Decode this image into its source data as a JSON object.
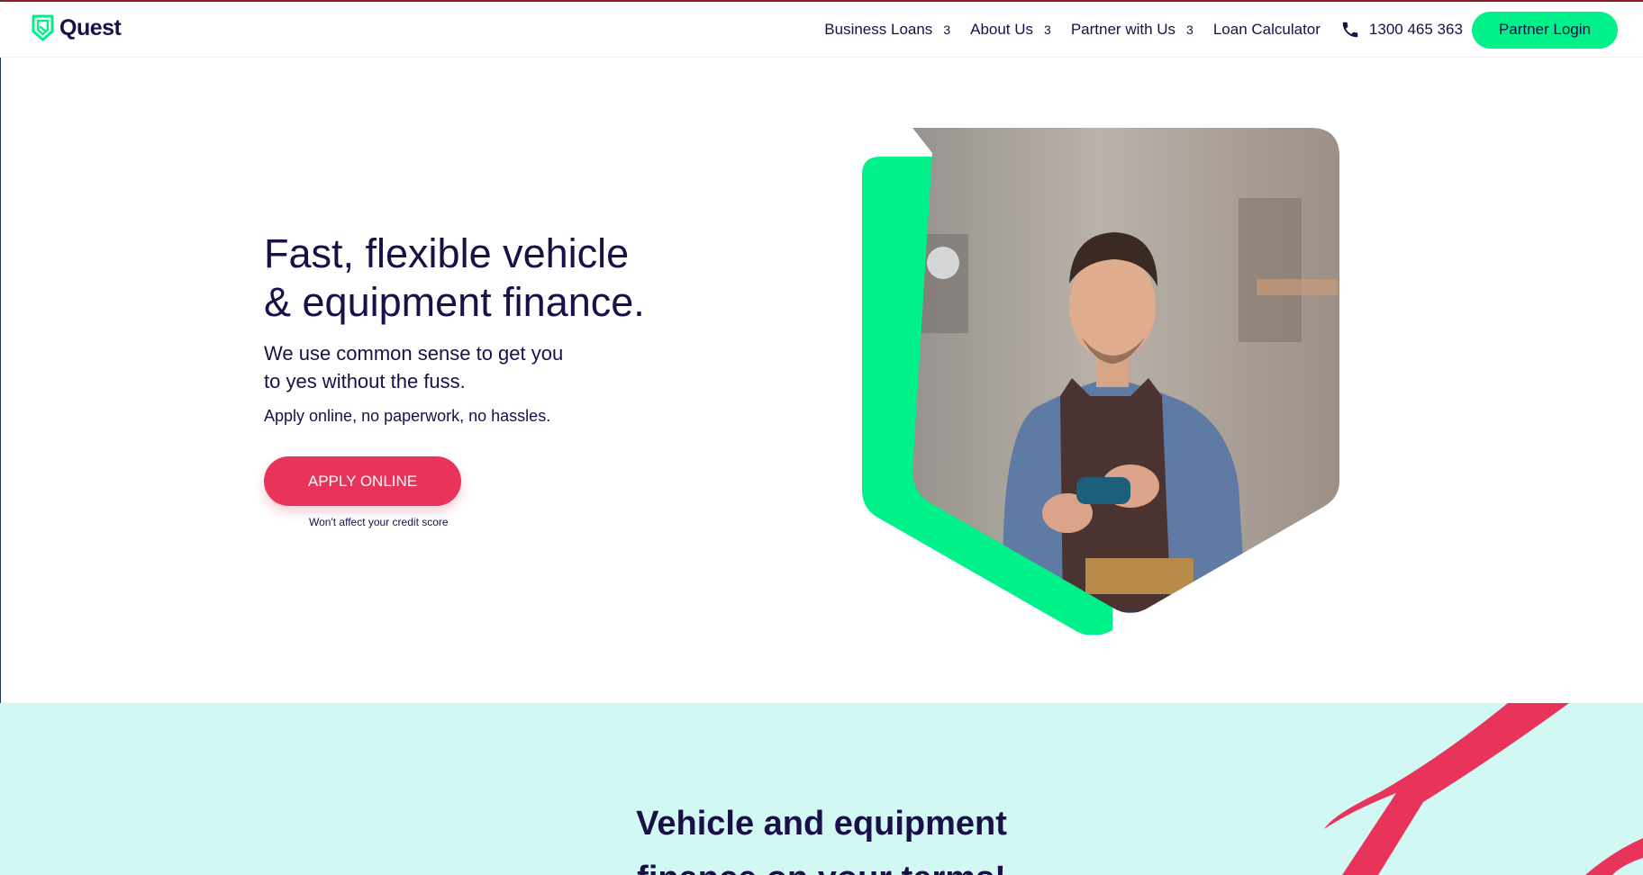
{
  "brand": {
    "name": "Quest",
    "accent": "#00f08a",
    "primary_text": "#1b0f4a",
    "cta": "#e8345b",
    "section_bg": "#d2f8f3"
  },
  "nav": {
    "items": [
      {
        "label": "Business Loans",
        "chevron": "3"
      },
      {
        "label": "About Us",
        "chevron": "3"
      },
      {
        "label": "Partner with Us",
        "chevron": "3"
      },
      {
        "label": "Loan Calculator"
      }
    ],
    "phone_icon": "phone-icon",
    "phone": "1300 465 363",
    "partner_login": "Partner Login"
  },
  "hero": {
    "title_line1": "Fast, flexible vehicle",
    "title_line2": "& equipment finance.",
    "subtitle_line1": "We use common sense to get you",
    "subtitle_line2": "to yes without the fuss.",
    "tagline": "Apply online, no paperwork, no hassles.",
    "cta": "APPLY ONLINE",
    "cta_note": "Won't affect your credit score"
  },
  "section2": {
    "title_line1": "Vehicle and equipment",
    "title_line2": "finance on your terms!"
  }
}
